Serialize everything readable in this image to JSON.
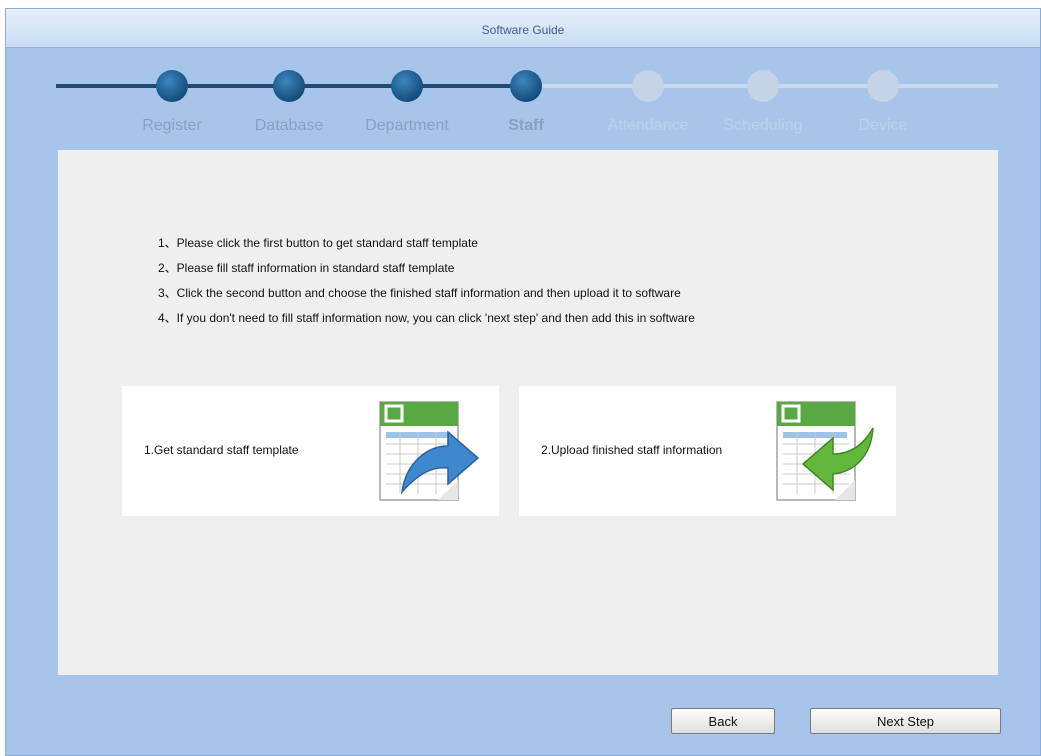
{
  "window": {
    "title": "Software Guide"
  },
  "steps": [
    {
      "label": "Register",
      "state": "done"
    },
    {
      "label": "Database",
      "state": "done"
    },
    {
      "label": "Department",
      "state": "done"
    },
    {
      "label": "Staff",
      "state": "current"
    },
    {
      "label": "Attendance",
      "state": "todo"
    },
    {
      "label": "Scheduling",
      "state": "todo"
    },
    {
      "label": "Device",
      "state": "todo"
    }
  ],
  "instructions": [
    "1、Please click the first button to get standard staff template",
    "2、Please fill staff information in standard staff template",
    "3、Click the second button and choose the finished staff information and then upload it to software",
    "4、If you don't need to fill staff information now, you can click 'next step' and then add this in software"
  ],
  "cards": {
    "get_template": {
      "label": "1.Get standard staff template",
      "icon": "spreadsheet-export-icon"
    },
    "upload": {
      "label": "2.Upload finished staff information",
      "icon": "spreadsheet-import-icon"
    }
  },
  "footer": {
    "back_label": "Back",
    "next_label": "Next Step"
  },
  "colors": {
    "background": "#a7c5ea",
    "step_done": "#1e4a74",
    "step_todo": "#c4d3e6",
    "panel": "#efefef"
  }
}
